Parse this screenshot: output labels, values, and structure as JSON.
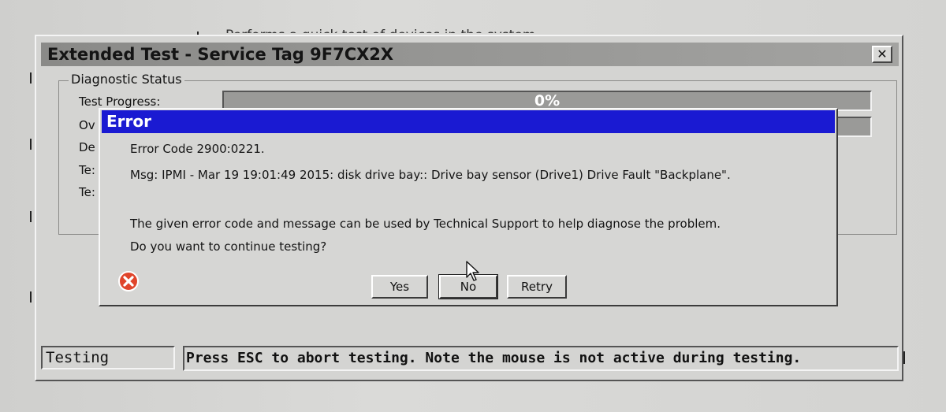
{
  "main_window": {
    "title": "Extended Test - Service Tag 9F7CX2X",
    "close_glyph": "✕",
    "group_title": "Diagnostic Status",
    "rows": {
      "test_progress": "Test Progress:",
      "overall_truncated": "Ov",
      "de_truncated": "De",
      "te1_truncated": "Te:",
      "te2_truncated": "Te:"
    },
    "progress_text": "0%",
    "status_left": "Testing",
    "status_right": "Press ESC to abort testing.  Note the mouse is not active during testing."
  },
  "background": {
    "partial_text": "Performs a quick test of devices in the system"
  },
  "error_dialog": {
    "title": "Error",
    "error_code_line": "Error Code  2900:0221.",
    "msg_line": "Msg: IPMI - Mar 19 19:01:49 2015: disk drive bay:: Drive bay sensor (Drive1) Drive Fault \"Backplane\".",
    "info_line": "The given error code and message can be used by Technical Support to help diagnose the problem.",
    "question_line": "Do you want to continue testing?",
    "buttons": {
      "yes": "Yes",
      "no": "No",
      "retry": "Retry"
    },
    "icon": "error-x-icon"
  },
  "colors": {
    "error_titlebar": "#1a1ad2",
    "main_titlebar": "#8a8a88",
    "progress_bar": "#9a9a98",
    "error_icon": "#e0452b"
  }
}
